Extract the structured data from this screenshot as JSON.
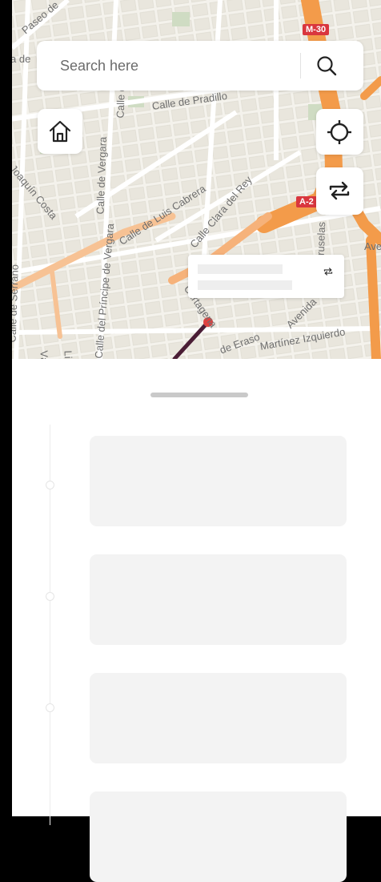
{
  "map": {
    "streets": [
      {
        "text": "Paseo de"
      },
      {
        "text": "a de"
      },
      {
        "text": "Calle de Pradillo"
      },
      {
        "text": "Calle de"
      },
      {
        "text": "Calle de Vergara"
      },
      {
        "text": "Calle de Luis Cabrera"
      },
      {
        "text": "Calle Clara del Rey"
      },
      {
        "text": "Calle de Serrano"
      },
      {
        "text": "Calle del Príncipe de Vergara"
      },
      {
        "text": "Joaquín Costa"
      },
      {
        "text": "Cartagena"
      },
      {
        "text": "de Eraso"
      },
      {
        "text": "Martínez Izquierdo"
      },
      {
        "text": "Avenida"
      },
      {
        "text": "Bruselas"
      },
      {
        "text": "Ave"
      },
      {
        "text": "Vázquez"
      },
      {
        "text": "Lisboa"
      }
    ],
    "road_badges": [
      "M-30",
      "A-2"
    ]
  },
  "search": {
    "placeholder": "Search here"
  },
  "buttons": {
    "home": "home-icon",
    "locate": "crosshair-icon",
    "swap": "swap-icon"
  },
  "colors": {
    "highway": "#f39b4a",
    "route_line": "#4a1d35",
    "route_dot": "#e0413f",
    "card_skeleton": "#f3f3f3"
  },
  "sheet": {
    "cards": [
      {},
      {},
      {},
      {}
    ]
  }
}
